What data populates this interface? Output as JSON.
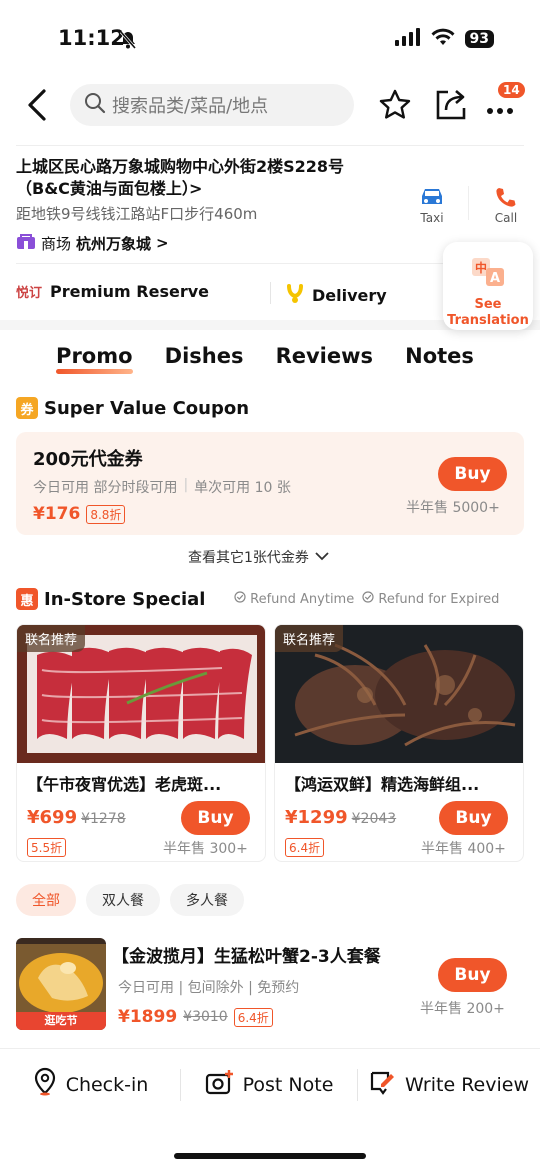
{
  "status": {
    "time": "11:12",
    "battery": "93"
  },
  "header": {
    "search_placeholder": "搜索品类/菜品/地点",
    "more_badge": "14"
  },
  "address": {
    "line1": "上城区民心路万象城购物中心外街2楼S228号（B&C黄油与面包楼上）",
    "distance": "距地铁9号线钱江路站F口步行460m",
    "mall_label": "商场",
    "mall_name": "杭州万象城",
    "taxi_label": "Taxi",
    "call_label": "Call"
  },
  "features": {
    "reserve_icon": "悦订",
    "reserve": "Premium Reserve",
    "delivery": "Delivery"
  },
  "translate": {
    "label1": "See",
    "label2": "Translation"
  },
  "tabs": [
    "Promo",
    "Dishes",
    "Reviews",
    "Notes"
  ],
  "coupon_section": {
    "icon": "券",
    "title": "Super Value Coupon",
    "name": "200元代金券",
    "conditions": "今日可用 部分时段可用",
    "limit": "单次可用 10 张",
    "price": "¥176",
    "discount": "8.8折",
    "buy": "Buy",
    "sold": "半年售 5000+",
    "more": "查看其它1张代金券"
  },
  "special_section": {
    "icon": "惠",
    "title": "In-Store Special",
    "refund1": "Refund Anytime",
    "refund2": "Refund for Expired",
    "cards": [
      {
        "tag": "联名推荐",
        "title": "【午市夜宵优选】老虎斑...",
        "price": "¥699",
        "orig": "¥1278",
        "discount": "5.5折",
        "buy": "Buy",
        "sold": "半年售 300+"
      },
      {
        "tag": "联名推荐",
        "title": "【鸿运双鲜】精选海鲜组...",
        "price": "¥1299",
        "orig": "¥2043",
        "discount": "6.4折",
        "buy": "Buy",
        "sold": "半年售 400+"
      }
    ]
  },
  "filters": [
    "全部",
    "双人餐",
    "多人餐"
  ],
  "package": {
    "title": "【金波揽月】生猛松叶蟹2-3人套餐",
    "conditions": "今日可用 | 包间除外 | 免预约",
    "price": "¥1899",
    "orig": "¥3010",
    "discount": "6.4折",
    "buy": "Buy",
    "sold": "半年售 200+",
    "img_tag": "逛吃节"
  },
  "bottom": {
    "checkin": "Check-in",
    "post": "Post Note",
    "review": "Write Review"
  },
  "colors": {
    "accent": "#f0562a",
    "coupon_bg": "#fdf2ec"
  }
}
